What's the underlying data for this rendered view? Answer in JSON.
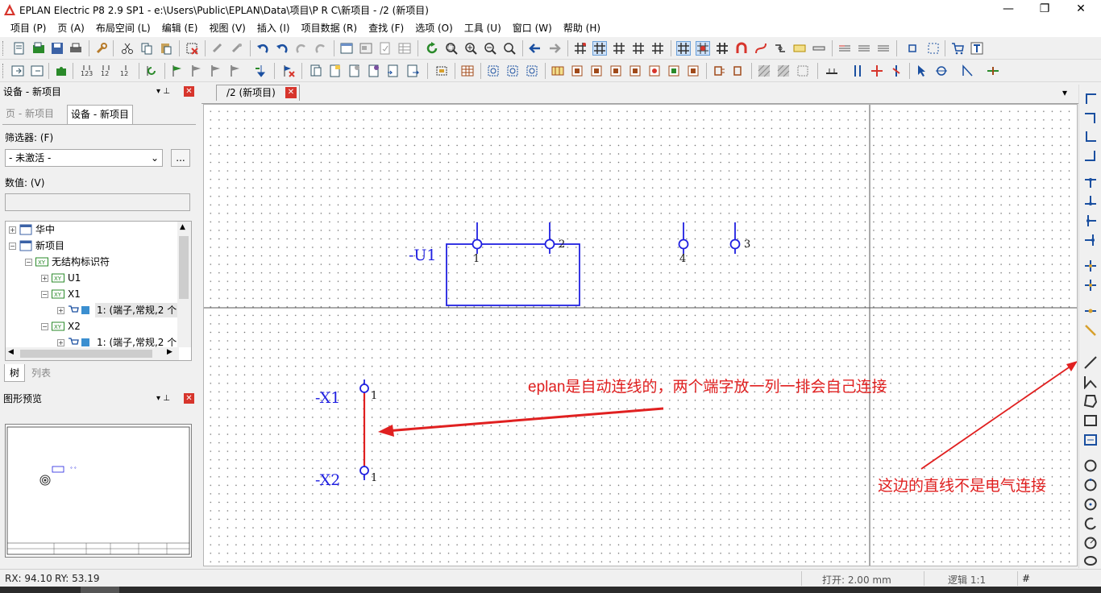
{
  "titlebar": {
    "title": "EPLAN Electric P8 2.9 SP1 - e:\\Users\\Public\\EPLAN\\Data\\项目\\P R C\\新项目 - /2 (新项目)",
    "minimize": "—",
    "restore": "❐",
    "close": "✕"
  },
  "menu": [
    "项目 (P)",
    "页 (A)",
    "布局空间 (L)",
    "编辑 (E)",
    "视图 (V)",
    "插入 (I)",
    "项目数据 (R)",
    "查找 (F)",
    "选项 (O)",
    "工具 (U)",
    "窗口 (W)",
    "帮助 (H)"
  ],
  "device_panel": {
    "title": "设备 - 新项目",
    "pin": "▾ ⊥",
    "close": "✕",
    "tabs": [
      "页 - 新项目",
      "设备 - 新项目"
    ],
    "filter_label": "筛选器: (F)",
    "filter_value": "- 未激活 -",
    "filter_more": "...",
    "value_label": "数值: (V)",
    "value_input": "",
    "tree": [
      {
        "label": "华中",
        "toggle": "+",
        "icon": "page-icon"
      },
      {
        "label": "新项目",
        "toggle": "−",
        "icon": "page-icon"
      },
      {
        "label": "无结构标识符",
        "toggle": "−",
        "icon": "xy-icon"
      },
      {
        "label": "U1",
        "toggle": "+",
        "icon": "xy-icon"
      },
      {
        "label": "X1",
        "toggle": "−",
        "icon": "xy-icon"
      },
      {
        "label": "1: (端子,常规,2 个",
        "toggle": "+",
        "icon": "terminal-icon",
        "selected": true
      },
      {
        "label": "X2",
        "toggle": "−",
        "icon": "xy-icon"
      },
      {
        "label": "1: (端子,常规,2 个",
        "toggle": "+",
        "icon": "terminal-icon",
        "selected": false
      }
    ],
    "bottom_tabs": [
      "树",
      "列表"
    ]
  },
  "preview_panel": {
    "title": "图形预览",
    "pin": "▾ ⊥",
    "close": "✕"
  },
  "doc_tab": {
    "label": "/2 (新项目)",
    "close": "✕",
    "dropdown": "▾"
  },
  "schematic": {
    "devices": [
      {
        "tag": "-U1",
        "pins": [
          "1",
          "2"
        ]
      },
      {
        "tag": "",
        "pins": [
          "4",
          "3"
        ]
      },
      {
        "tag": "-X1",
        "pins": [
          "1"
        ]
      },
      {
        "tag": "-X2",
        "pins": [
          "1"
        ]
      }
    ],
    "annotation_1": "eplan是自动连线的，两个端字放一列一排会自己连接",
    "annotation_2": "这边的直线不是电气连接",
    "colors": {
      "symbol": "#2020e0",
      "connection": "#e02020",
      "annotation": "#e02020"
    }
  },
  "statusbar": {
    "rx": "RX: 94.10",
    "ry": "RY: 53.19",
    "snap": "打开: 2.00 mm",
    "logic": "逻辑 1:1",
    "hash": "#"
  }
}
